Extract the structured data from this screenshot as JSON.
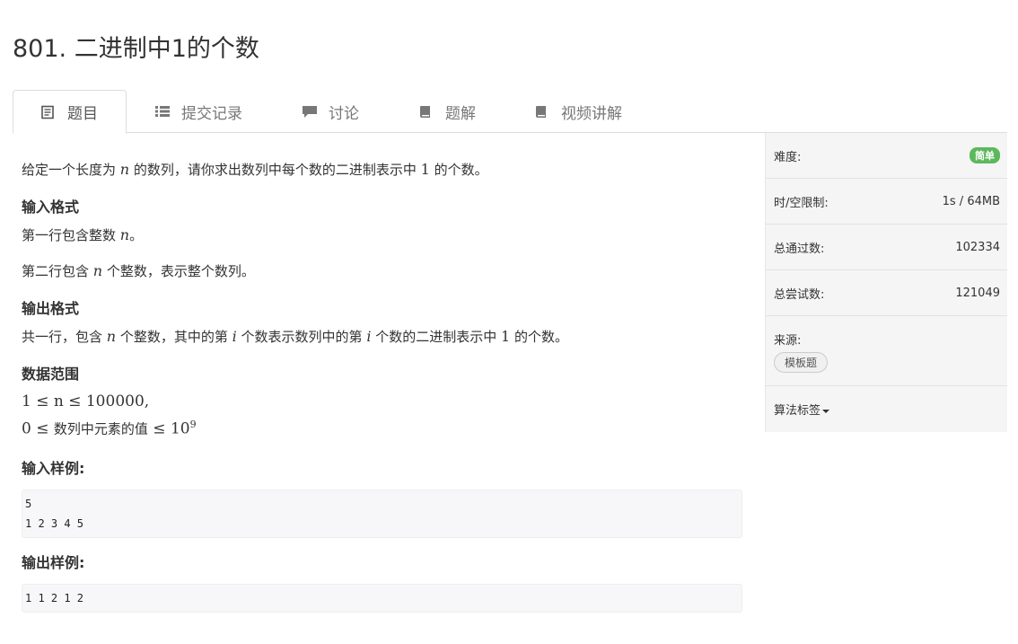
{
  "problem": {
    "title": "801. 二进制中1的个数"
  },
  "tabs": [
    {
      "label": "题目",
      "icon": "document-icon"
    },
    {
      "label": "提交记录",
      "icon": "list-icon"
    },
    {
      "label": "讨论",
      "icon": "comment-icon"
    },
    {
      "label": "题解",
      "icon": "book-icon"
    },
    {
      "label": "视频讲解",
      "icon": "book-icon"
    }
  ],
  "statement": {
    "intro_a": "给定一个长度为 ",
    "intro_var": "n",
    "intro_b": " 的数列，请你求出数列中每个数的二进制表示中 ",
    "intro_num": "1",
    "intro_c": " 的个数。",
    "input_heading": "输入格式",
    "input_line1_a": "第一行包含整数 ",
    "input_line1_var": "n",
    "input_line1_b": "。",
    "input_line2_a": "第二行包含 ",
    "input_line2_var": "n",
    "input_line2_b": " 个整数，表示整个数列。",
    "output_heading": "输出格式",
    "output_a": "共一行，包含 ",
    "output_var1": "n",
    "output_b": " 个整数，其中的第 ",
    "output_var2": "i",
    "output_c": " 个数表示数列中的第 ",
    "output_var3": "i",
    "output_d": " 个数的二进制表示中 ",
    "output_num": "1",
    "output_e": " 的个数。",
    "range_heading": "数据范围",
    "range_line1": "1 ≤ n ≤ 100000,",
    "range_line2_a": "0 ≤ ",
    "range_line2_zh": "数列中元素的值",
    "range_line2_b": " ≤ 10",
    "range_line2_sup": "9",
    "sample_in_heading": "输入样例:",
    "sample_in": "5\n1 2 3 4 5",
    "sample_out_heading": "输出样例:",
    "sample_out": "1 1 2 1 2"
  },
  "sidebar": {
    "difficulty_label": "难度:",
    "difficulty_value": "简单",
    "limit_label": "时/空限制:",
    "limit_value": "1s / 64MB",
    "accepted_label": "总通过数:",
    "accepted_value": "102334",
    "attempts_label": "总尝试数:",
    "attempts_value": "121049",
    "source_label": "来源:",
    "source_tag": "模板题",
    "algo_tags_label": "算法标签"
  },
  "colors": {
    "easy_badge": "#5cb85c",
    "sidebar_bg": "#f5f5f5"
  }
}
